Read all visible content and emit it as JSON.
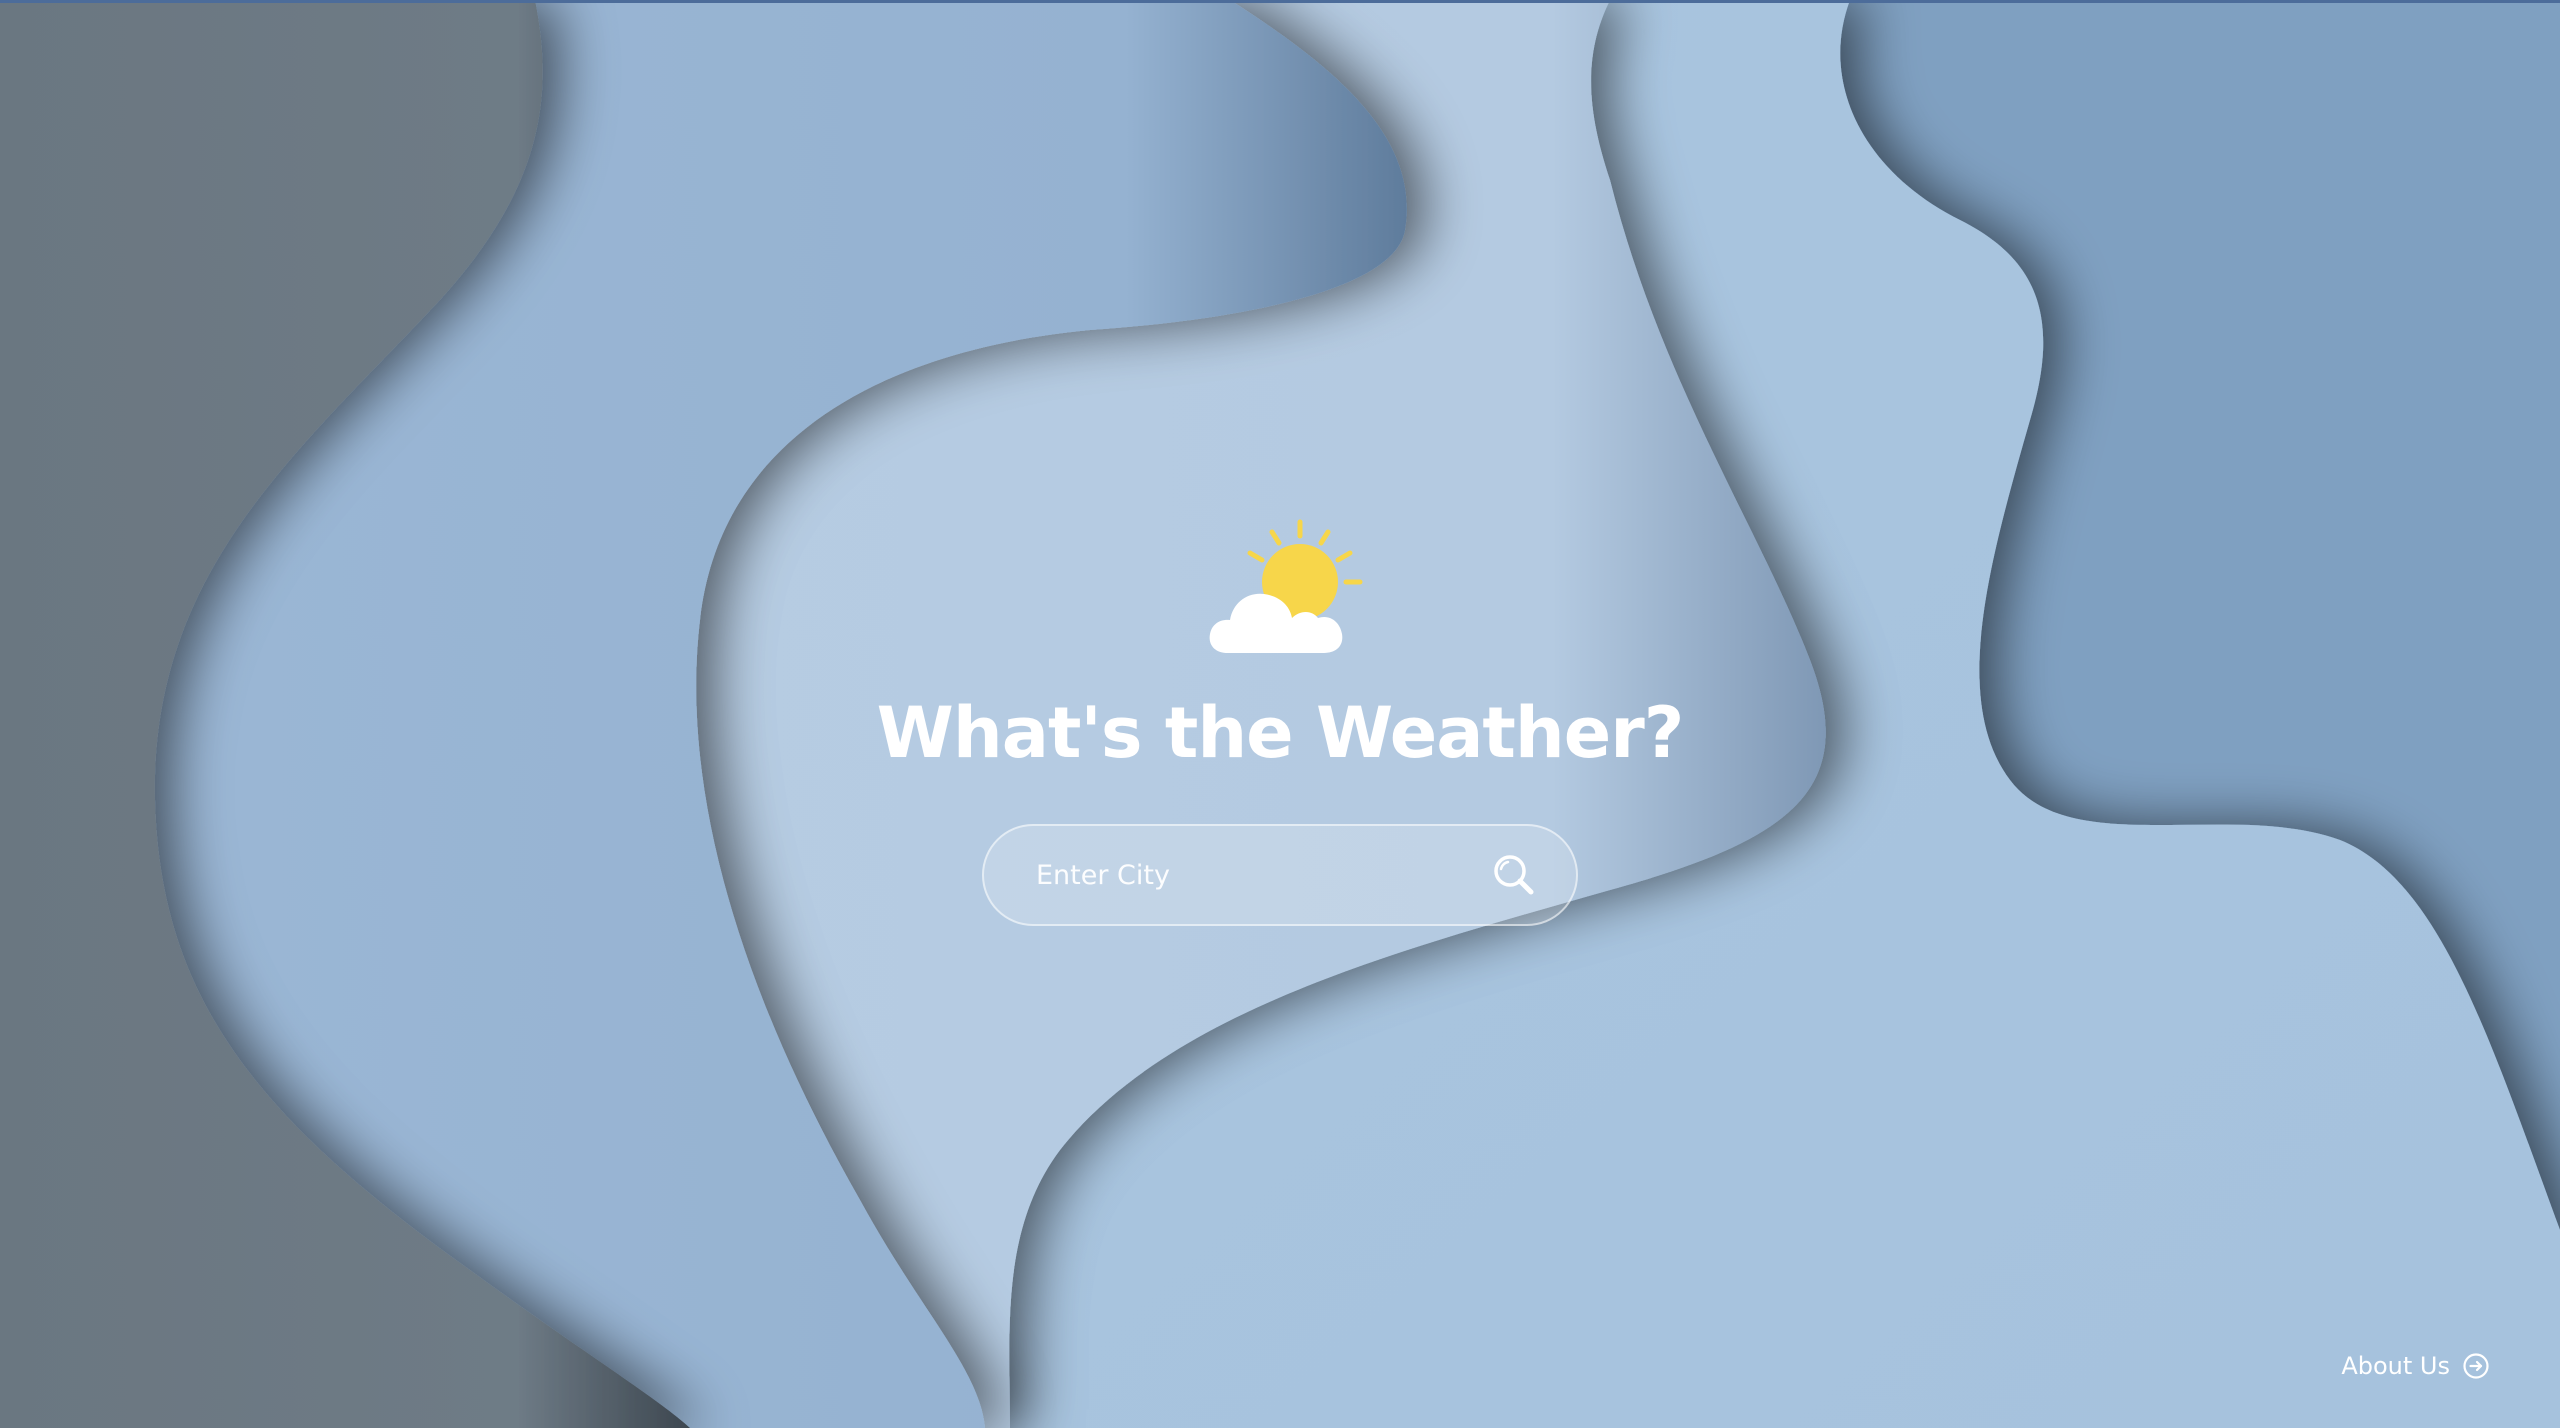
{
  "header": {
    "title": "What's the Weather?",
    "icon": "partly-cloudy-icon"
  },
  "search": {
    "placeholder": "Enter City",
    "value": "",
    "button_icon": "search-icon"
  },
  "footer": {
    "about_label": "About Us",
    "about_icon": "arrow-right-circle-icon"
  },
  "colors": {
    "background": "#7f9fc0",
    "wave_dark": "#6e7b85",
    "wave_mid": "#98b5d4",
    "wave_light": "#b6cce2",
    "wave_lighter": "#a9c5df",
    "sun": "#f7d64a",
    "text": "#ffffff"
  }
}
